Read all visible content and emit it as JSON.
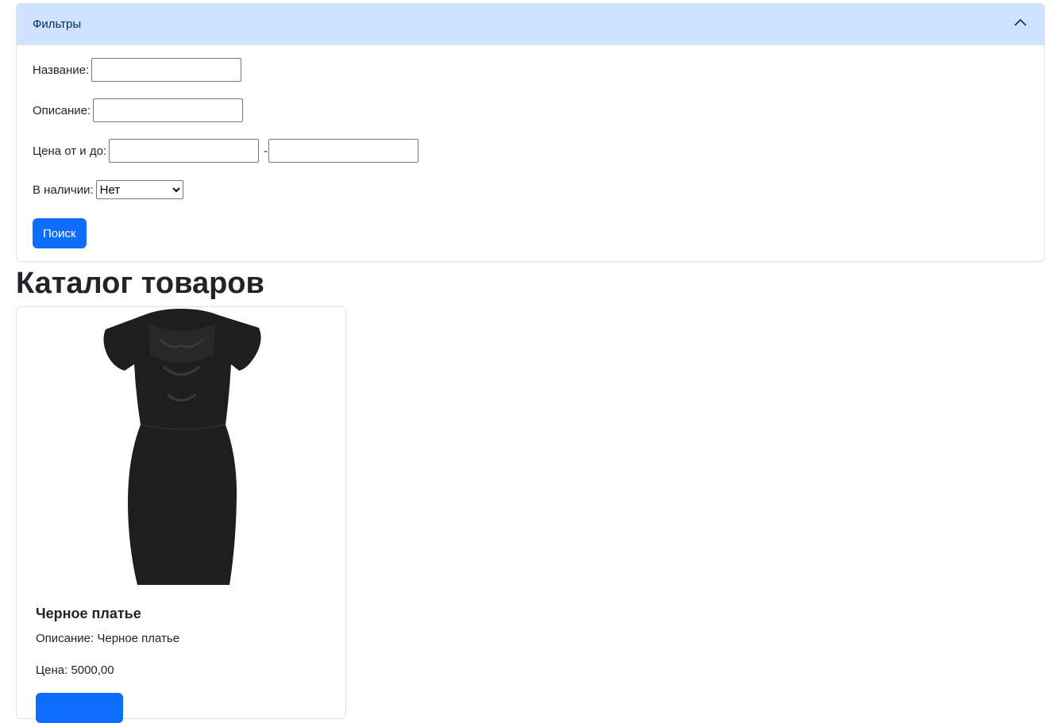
{
  "filters": {
    "header_title": "Фильтры",
    "name_label": "Название:",
    "name_value": "",
    "description_label": "Описание:",
    "description_value": "",
    "price_label": "Цена от и до:",
    "price_from_value": "",
    "price_separator": "-",
    "price_to_value": "",
    "stock_label": "В наличии:",
    "stock_selected": "Нет",
    "search_button": "Поиск"
  },
  "catalog": {
    "title": "Каталог товаров",
    "products": [
      {
        "name": "Черное платье",
        "description": "Описание: Черное платье",
        "price": "Цена: 5000,00"
      }
    ]
  },
  "colors": {
    "accordion_header_bg": "#cfe2ff",
    "primary": "#0d6efd"
  }
}
